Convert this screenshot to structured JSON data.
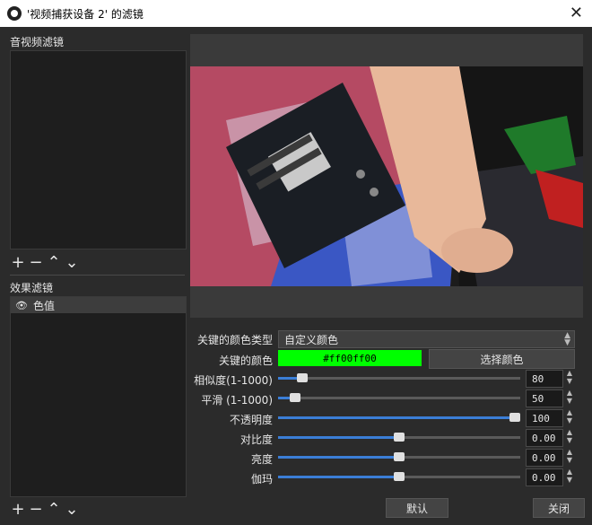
{
  "window": {
    "title": "'视频捕获设备 2' 的滤镜",
    "close_glyph": "✕"
  },
  "audio_filters": {
    "label": "音视频滤镜",
    "items": []
  },
  "effect_filters": {
    "label": "效果滤镜",
    "items": [
      {
        "name": "色值",
        "visible": true
      }
    ]
  },
  "toolbar": {
    "add": "+",
    "remove": "−",
    "up": "⌃",
    "down": "⌄"
  },
  "properties": {
    "key_color_type": {
      "label": "关键的颜色类型",
      "value": "自定义颜色"
    },
    "key_color": {
      "label": "关键的颜色",
      "value": "#ff00ff00",
      "button": "选择颜色"
    },
    "similarity": {
      "label": "相似度(1-1000)",
      "value": "80",
      "fraction": 0.08
    },
    "smoothness": {
      "label": "平滑 (1-1000)",
      "value": "50",
      "fraction": 0.05
    },
    "opacity": {
      "label": "不透明度",
      "value": "100",
      "fraction": 1.0
    },
    "contrast": {
      "label": "对比度",
      "value": "0.00",
      "fraction": 0.5
    },
    "brightness": {
      "label": "亮度",
      "value": "0.00",
      "fraction": 0.5
    },
    "gamma": {
      "label": "伽玛",
      "value": "0.00",
      "fraction": 0.5
    }
  },
  "buttons": {
    "defaults": "默认",
    "close": "关闭"
  },
  "colors": {
    "key_green": "#00ff00",
    "accent": "#3b7ed6"
  }
}
